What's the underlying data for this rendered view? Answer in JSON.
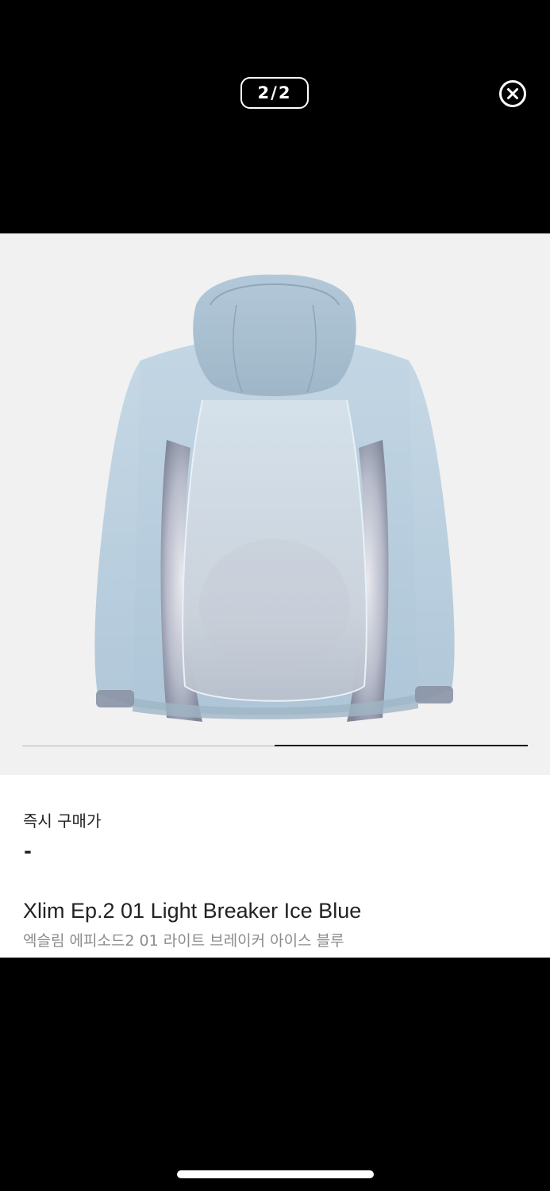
{
  "viewer": {
    "page_indicator": "2/2",
    "current_page": 2,
    "total_pages": 2,
    "close_icon": "close-circle-icon"
  },
  "gallery": {
    "image_alt": "Xlim Ep.2 01 Light Breaker Ice Blue",
    "progress_fraction": 0.5,
    "background_color": "#f1f1f1",
    "jacket_color": "#b7cddd"
  },
  "product": {
    "price_label": "즉시 구매가",
    "price_value": "-",
    "name": "Xlim Ep.2 01 Light Breaker Ice Blue",
    "name_ko": "엑슬림 에피소드2 01 라이트 브레이커 아이스 블루"
  }
}
